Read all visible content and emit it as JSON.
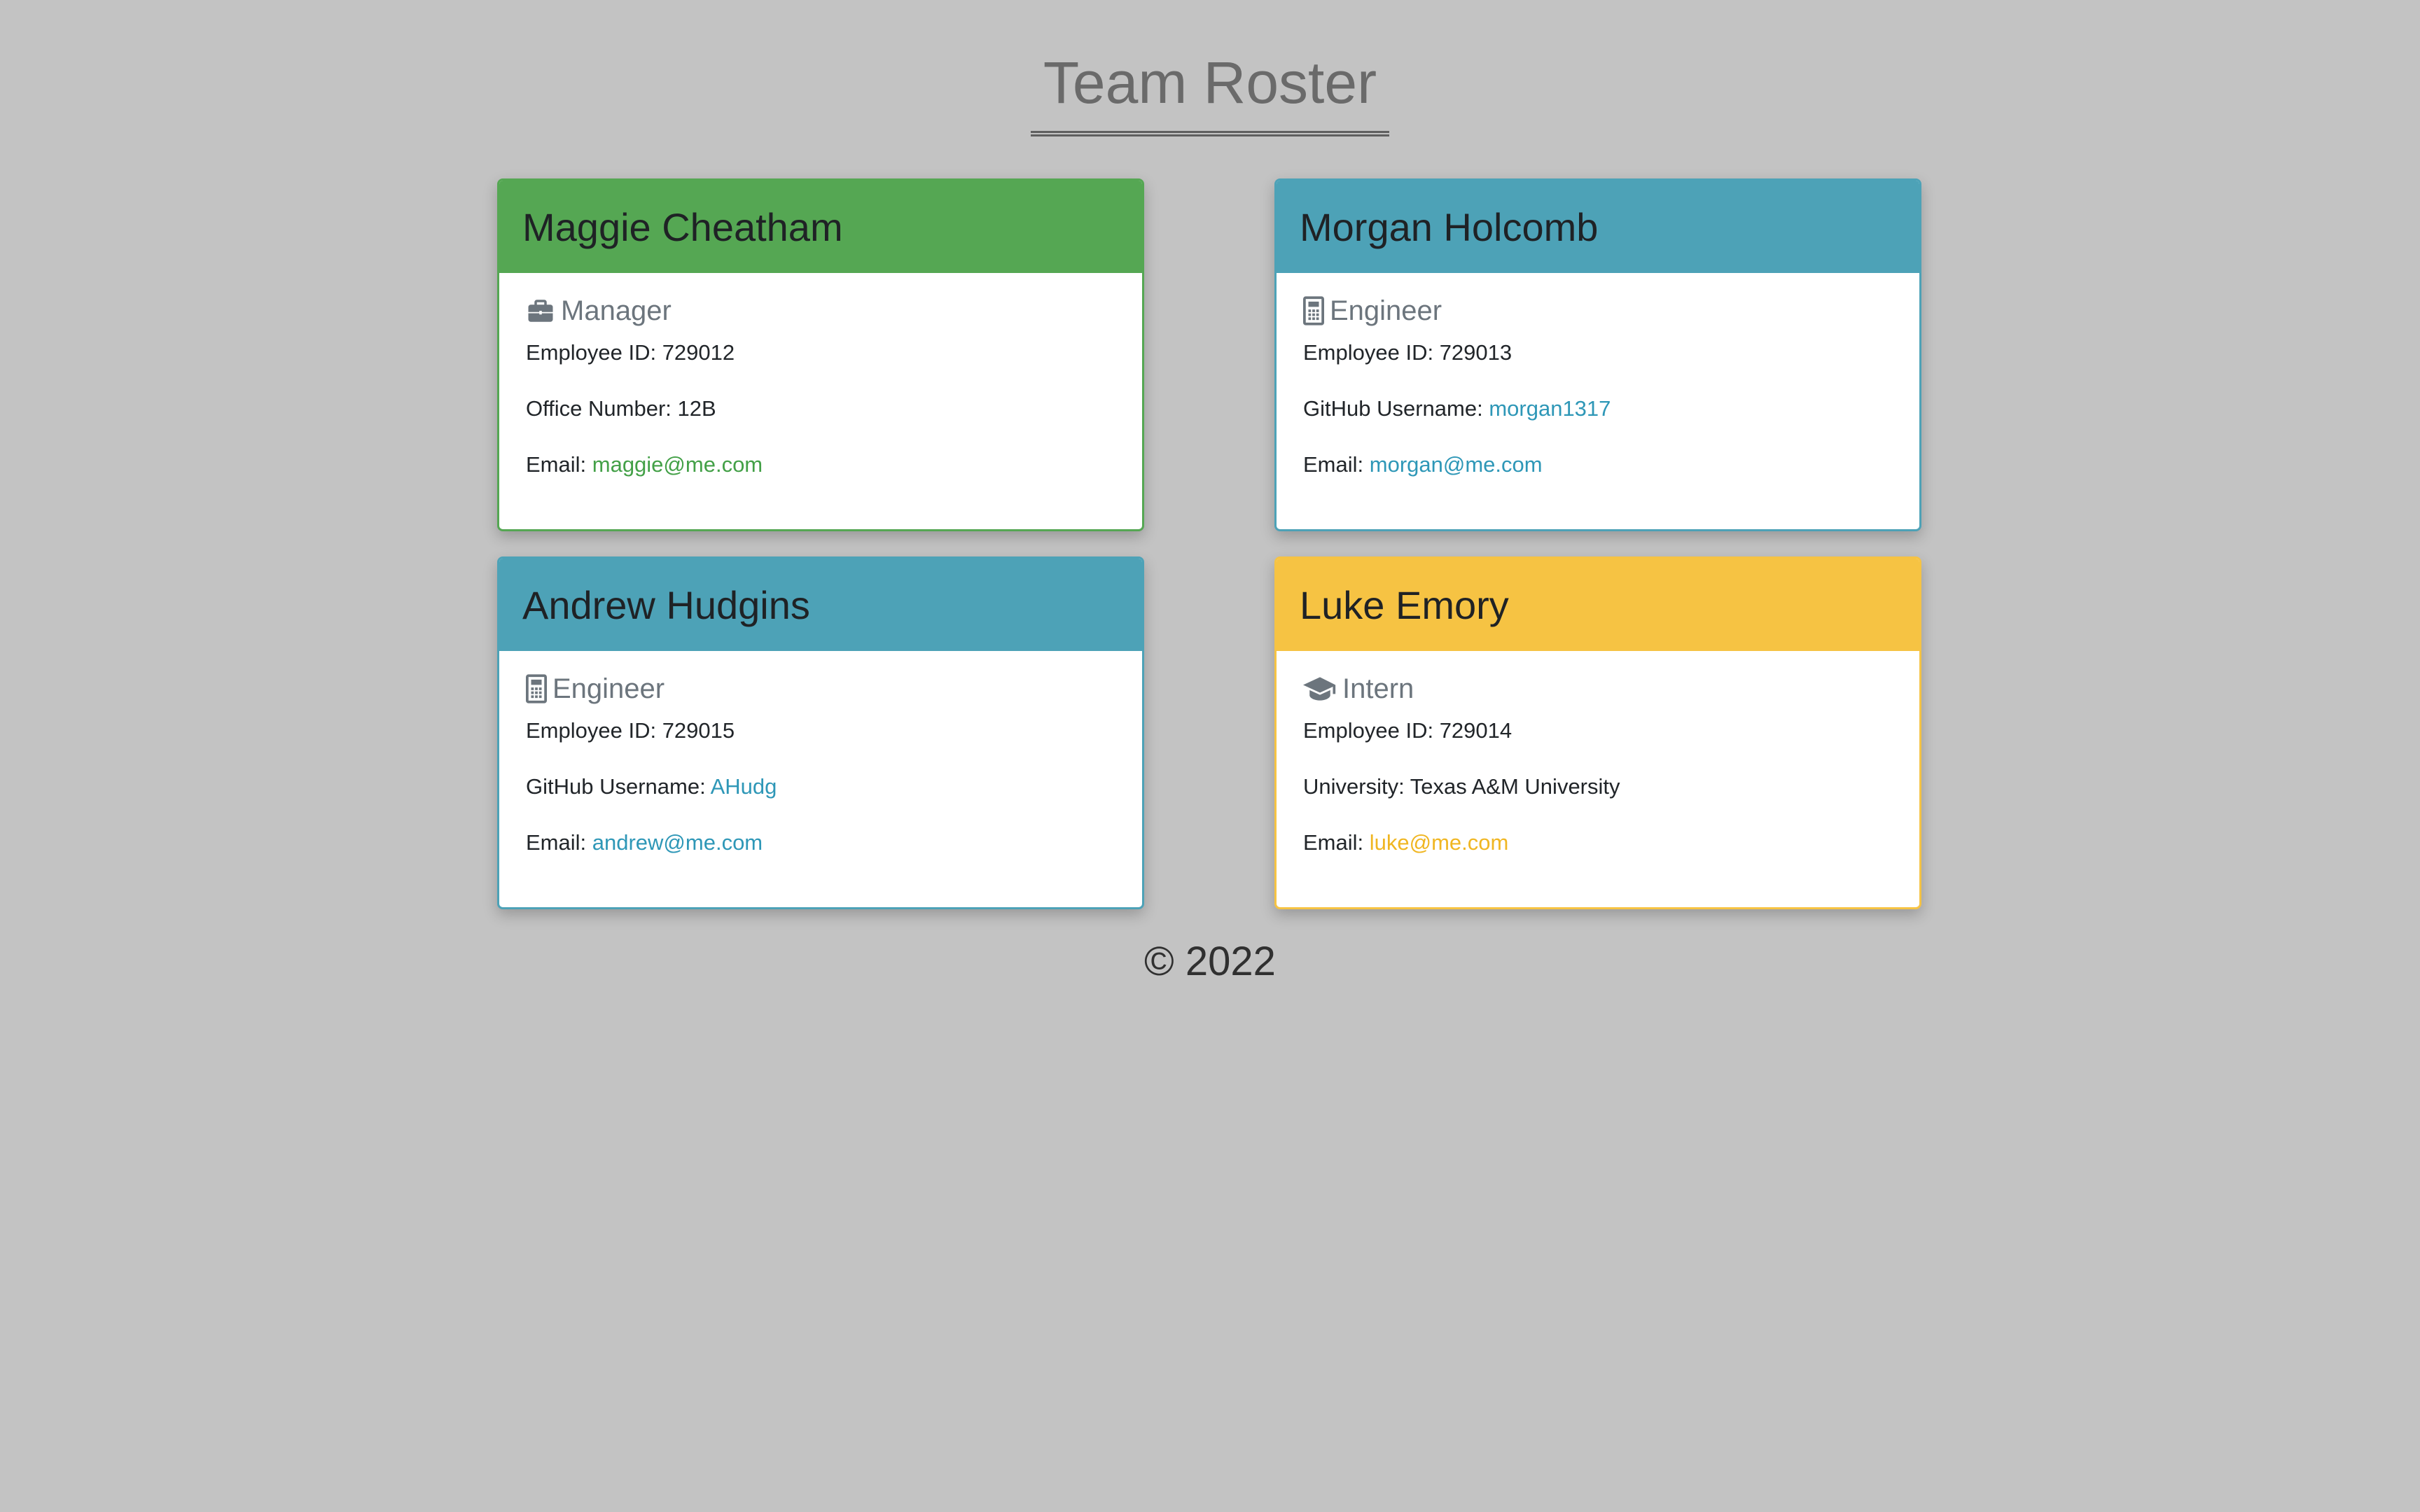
{
  "page": {
    "title": "Team Roster",
    "footer": "© 2022"
  },
  "colors": {
    "background": "#c3c3c3",
    "manager": "#55a753",
    "engineer": "#4da2b7",
    "intern": "#f6c343"
  },
  "cards": [
    {
      "name": "Maggie Cheatham",
      "role": "Manager",
      "icon": "briefcase-icon",
      "employee_id": "Employee ID: 729012",
      "detail_label": "Office Number: ",
      "detail_value": "12B",
      "email_label": "Email: ",
      "email": "maggie@me.com"
    },
    {
      "name": "Morgan Holcomb",
      "role": "Engineer",
      "icon": "calculator-icon",
      "employee_id": "Employee ID: 729013",
      "detail_label": "GitHub Username: ",
      "detail_value": "morgan1317",
      "email_label": "Email: ",
      "email": "morgan@me.com"
    },
    {
      "name": "Andrew Hudgins",
      "role": "Engineer",
      "icon": "calculator-icon",
      "employee_id": "Employee ID: 729015",
      "detail_label": "GitHub Username: ",
      "detail_value": "AHudg",
      "email_label": "Email: ",
      "email": "andrew@me.com"
    },
    {
      "name": "Luke Emory",
      "role": "Intern",
      "icon": "graduation-cap-icon",
      "employee_id": "Employee ID: 729014",
      "detail_label": "University: ",
      "detail_value": "Texas A&M University",
      "email_label": "Email: ",
      "email": "luke@me.com"
    }
  ]
}
